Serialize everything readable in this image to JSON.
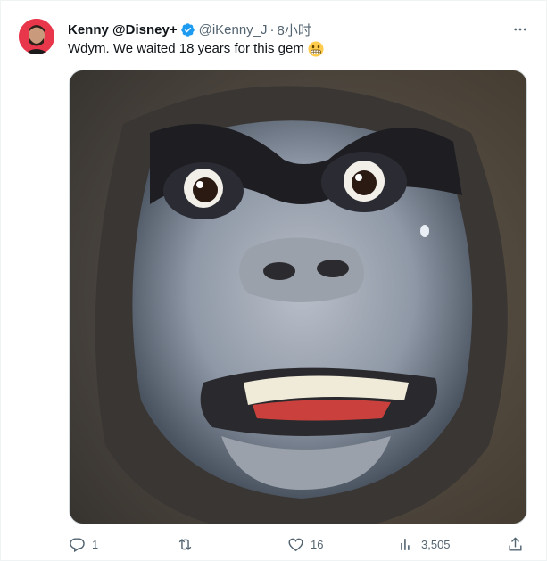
{
  "tweet": {
    "display_name": "Kenny @Disney+",
    "handle": "@iKenny_J",
    "separator": "·",
    "timestamp": "8小时",
    "text": "Wdym. We waited 18 years for this gem",
    "emoji": "grimacing-face-emoji",
    "media_description": "Close-up of an animatronic gorilla face with wide eyes and bared teeth"
  },
  "actions": {
    "reply_count": "1",
    "retweet_count": "",
    "like_count": "16",
    "views_count": "3,505"
  },
  "colors": {
    "text_primary": "#0f1419",
    "text_secondary": "#536471",
    "verified_blue": "#1d9bf0",
    "border": "#eff3f4"
  },
  "icons": [
    "verified-badge-icon",
    "more-icon",
    "reply-icon",
    "retweet-icon",
    "like-icon",
    "views-icon",
    "share-icon"
  ]
}
